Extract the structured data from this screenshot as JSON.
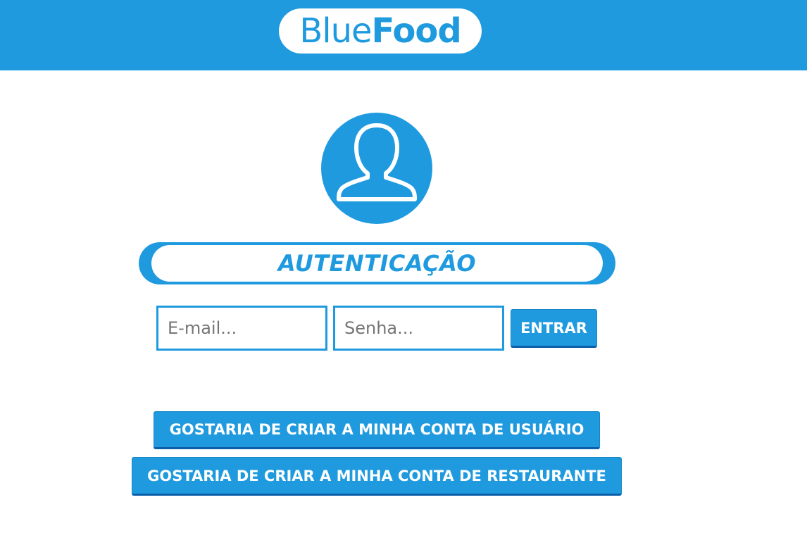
{
  "header": {
    "logo_part1": "Blue",
    "logo_part2": "Food"
  },
  "auth": {
    "avatar_icon": "user-icon",
    "title": "AUTENTICAÇÃO",
    "email_placeholder": "E-mail...",
    "password_placeholder": "Senha...",
    "email_value": "",
    "password_value": "",
    "login_label": "ENTRAR"
  },
  "actions": {
    "create_user_label": "GOSTARIA DE CRIAR A MINHA CONTA DE USUÁRIO",
    "create_restaurant_label": "GOSTARIA DE CRIAR A MINHA CONTA DE RESTAURANTE"
  },
  "colors": {
    "brand_blue": "#1f9adf",
    "button_border": "#0b5fa8",
    "background": "#ffffff"
  }
}
